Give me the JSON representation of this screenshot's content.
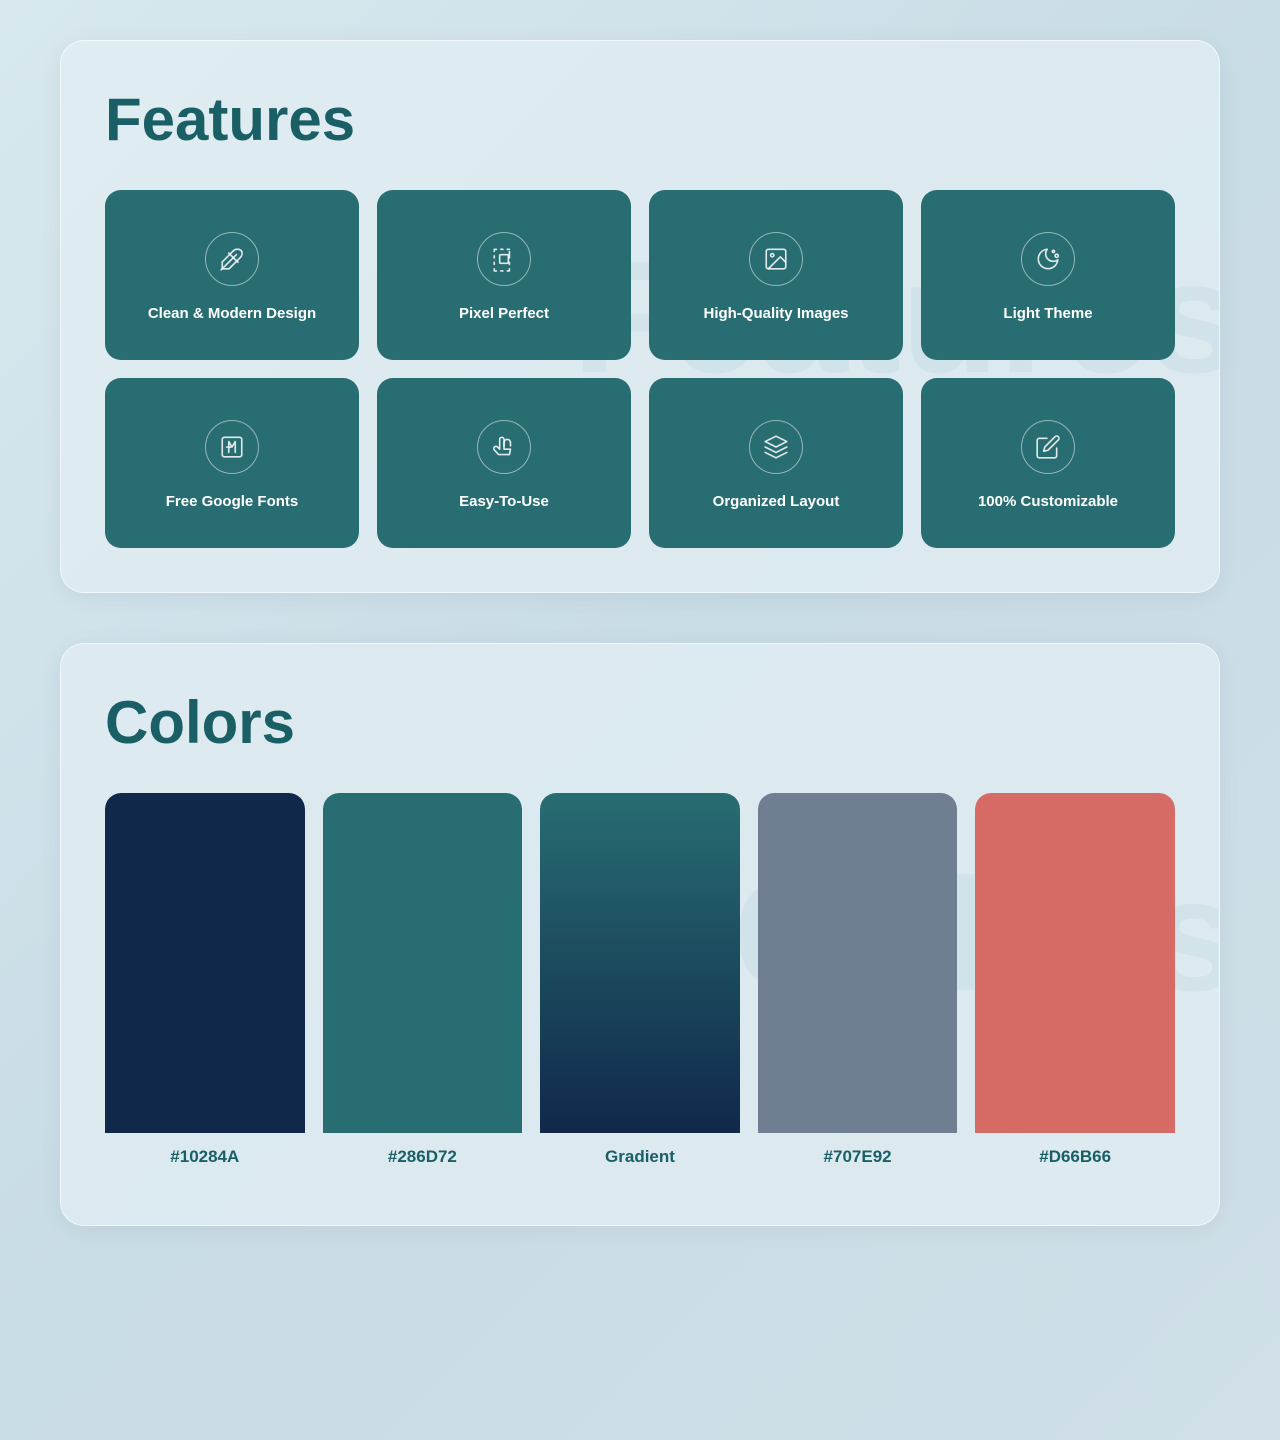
{
  "features": {
    "section_title": "Features",
    "section_bg_text": "Features",
    "cards": [
      {
        "id": "clean-design",
        "label": "Clean & Modern Design",
        "icon": "brush"
      },
      {
        "id": "pixel-perfect",
        "label": "Pixel Perfect",
        "icon": "vector"
      },
      {
        "id": "high-quality",
        "label": "High-Quality Images",
        "icon": "image"
      },
      {
        "id": "light-theme",
        "label": "Light Theme",
        "icon": "moon"
      },
      {
        "id": "google-fonts",
        "label": "Free Google Fonts",
        "icon": "font"
      },
      {
        "id": "easy-to-use",
        "label": "Easy-To-Use",
        "icon": "touch"
      },
      {
        "id": "organized",
        "label": "Organized Layout",
        "icon": "layers"
      },
      {
        "id": "customizable",
        "label": "100% Customizable",
        "icon": "edit"
      }
    ]
  },
  "colors": {
    "section_title": "Colors",
    "section_bg_text": "Colors",
    "swatches": [
      {
        "id": "dark-navy",
        "label": "#10284A",
        "class": "dark-navy"
      },
      {
        "id": "teal",
        "label": "#286D72",
        "class": "teal"
      },
      {
        "id": "gradient",
        "label": "Gradient",
        "class": "gradient"
      },
      {
        "id": "gray",
        "label": "#707E92",
        "class": "gray"
      },
      {
        "id": "coral",
        "label": "#D66B66",
        "class": "coral"
      }
    ]
  }
}
